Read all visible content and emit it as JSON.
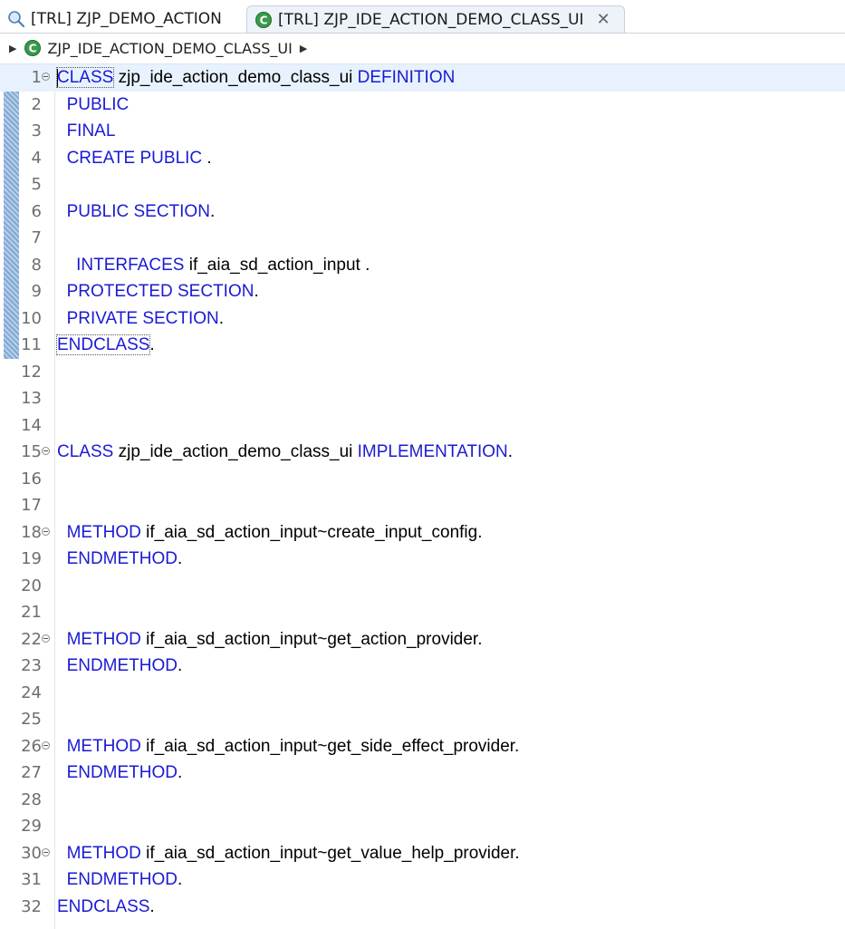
{
  "tabs": [
    {
      "label": "[TRL] ZJP_DEMO_ACTION",
      "icon": "search-object-icon",
      "active": false
    },
    {
      "label": "[TRL] ZJP_IDE_ACTION_DEMO_CLASS_UI",
      "icon": "abap-class-icon",
      "active": true,
      "close_glyph": "✕"
    }
  ],
  "breadcrumb": {
    "label": "ZJP_IDE_ACTION_DEMO_CLASS_UI"
  },
  "colors": {
    "keyword": "#1a1ad4",
    "text": "#000000",
    "line_number": "#6e6e6e",
    "current_line": "#e8f2fe"
  },
  "code_lines": [
    {
      "n": "1",
      "fold": true,
      "segments": [
        {
          "t": "CLASS",
          "kw": true,
          "boxed": true
        },
        {
          "t": " zjp_ide_action_demo_class_ui "
        },
        {
          "t": "DEFINITION",
          "kw": true
        }
      ]
    },
    {
      "n": "2",
      "segments": [
        {
          "t": "  "
        },
        {
          "t": "PUBLIC",
          "kw": true
        }
      ]
    },
    {
      "n": "3",
      "segments": [
        {
          "t": "  "
        },
        {
          "t": "FINAL",
          "kw": true
        }
      ]
    },
    {
      "n": "4",
      "segments": [
        {
          "t": "  "
        },
        {
          "t": "CREATE PUBLIC",
          "kw": true
        },
        {
          "t": " ."
        }
      ]
    },
    {
      "n": "5",
      "segments": []
    },
    {
      "n": "6",
      "segments": [
        {
          "t": "  "
        },
        {
          "t": "PUBLIC SECTION",
          "kw": true
        },
        {
          "t": "."
        }
      ]
    },
    {
      "n": "7",
      "segments": []
    },
    {
      "n": "8",
      "segments": [
        {
          "t": "    "
        },
        {
          "t": "INTERFACES",
          "kw": true
        },
        {
          "t": " if_aia_sd_action_input ."
        }
      ]
    },
    {
      "n": "9",
      "segments": [
        {
          "t": "  "
        },
        {
          "t": "PROTECTED SECTION",
          "kw": true
        },
        {
          "t": "."
        }
      ]
    },
    {
      "n": "10",
      "segments": [
        {
          "t": "  "
        },
        {
          "t": "PRIVATE SECTION",
          "kw": true
        },
        {
          "t": "."
        }
      ]
    },
    {
      "n": "11",
      "segments": [
        {
          "t": "ENDCLASS",
          "kw": true,
          "boxed": true
        },
        {
          "t": "."
        }
      ]
    },
    {
      "n": "12",
      "segments": []
    },
    {
      "n": "13",
      "segments": []
    },
    {
      "n": "14",
      "segments": []
    },
    {
      "n": "15",
      "fold": true,
      "segments": [
        {
          "t": "CLASS",
          "kw": true
        },
        {
          "t": " zjp_ide_action_demo_class_ui "
        },
        {
          "t": "IMPLEMENTATION",
          "kw": true
        },
        {
          "t": "."
        }
      ]
    },
    {
      "n": "16",
      "segments": []
    },
    {
      "n": "17",
      "segments": []
    },
    {
      "n": "18",
      "fold": true,
      "segments": [
        {
          "t": "  "
        },
        {
          "t": "METHOD",
          "kw": true
        },
        {
          "t": " if_aia_sd_action_input~create_input_config."
        }
      ]
    },
    {
      "n": "19",
      "segments": [
        {
          "t": "  "
        },
        {
          "t": "ENDMETHOD",
          "kw": true
        },
        {
          "t": "."
        }
      ]
    },
    {
      "n": "20",
      "segments": []
    },
    {
      "n": "21",
      "segments": []
    },
    {
      "n": "22",
      "fold": true,
      "segments": [
        {
          "t": "  "
        },
        {
          "t": "METHOD",
          "kw": true
        },
        {
          "t": " if_aia_sd_action_input~get_action_provider."
        }
      ]
    },
    {
      "n": "23",
      "segments": [
        {
          "t": "  "
        },
        {
          "t": "ENDMETHOD",
          "kw": true
        },
        {
          "t": "."
        }
      ]
    },
    {
      "n": "24",
      "segments": []
    },
    {
      "n": "25",
      "segments": []
    },
    {
      "n": "26",
      "fold": true,
      "segments": [
        {
          "t": "  "
        },
        {
          "t": "METHOD",
          "kw": true
        },
        {
          "t": " if_aia_sd_action_input~get_side_effect_provider."
        }
      ]
    },
    {
      "n": "27",
      "segments": [
        {
          "t": "  "
        },
        {
          "t": "ENDMETHOD",
          "kw": true
        },
        {
          "t": "."
        }
      ]
    },
    {
      "n": "28",
      "segments": []
    },
    {
      "n": "29",
      "segments": []
    },
    {
      "n": "30",
      "fold": true,
      "segments": [
        {
          "t": "  "
        },
        {
          "t": "METHOD",
          "kw": true
        },
        {
          "t": " if_aia_sd_action_input~get_value_help_provider."
        }
      ]
    },
    {
      "n": "31",
      "segments": [
        {
          "t": "  "
        },
        {
          "t": "ENDMETHOD",
          "kw": true
        },
        {
          "t": "."
        }
      ]
    },
    {
      "n": "32",
      "segments": [
        {
          "t": "ENDCLASS",
          "kw": true
        },
        {
          "t": "."
        }
      ]
    }
  ]
}
